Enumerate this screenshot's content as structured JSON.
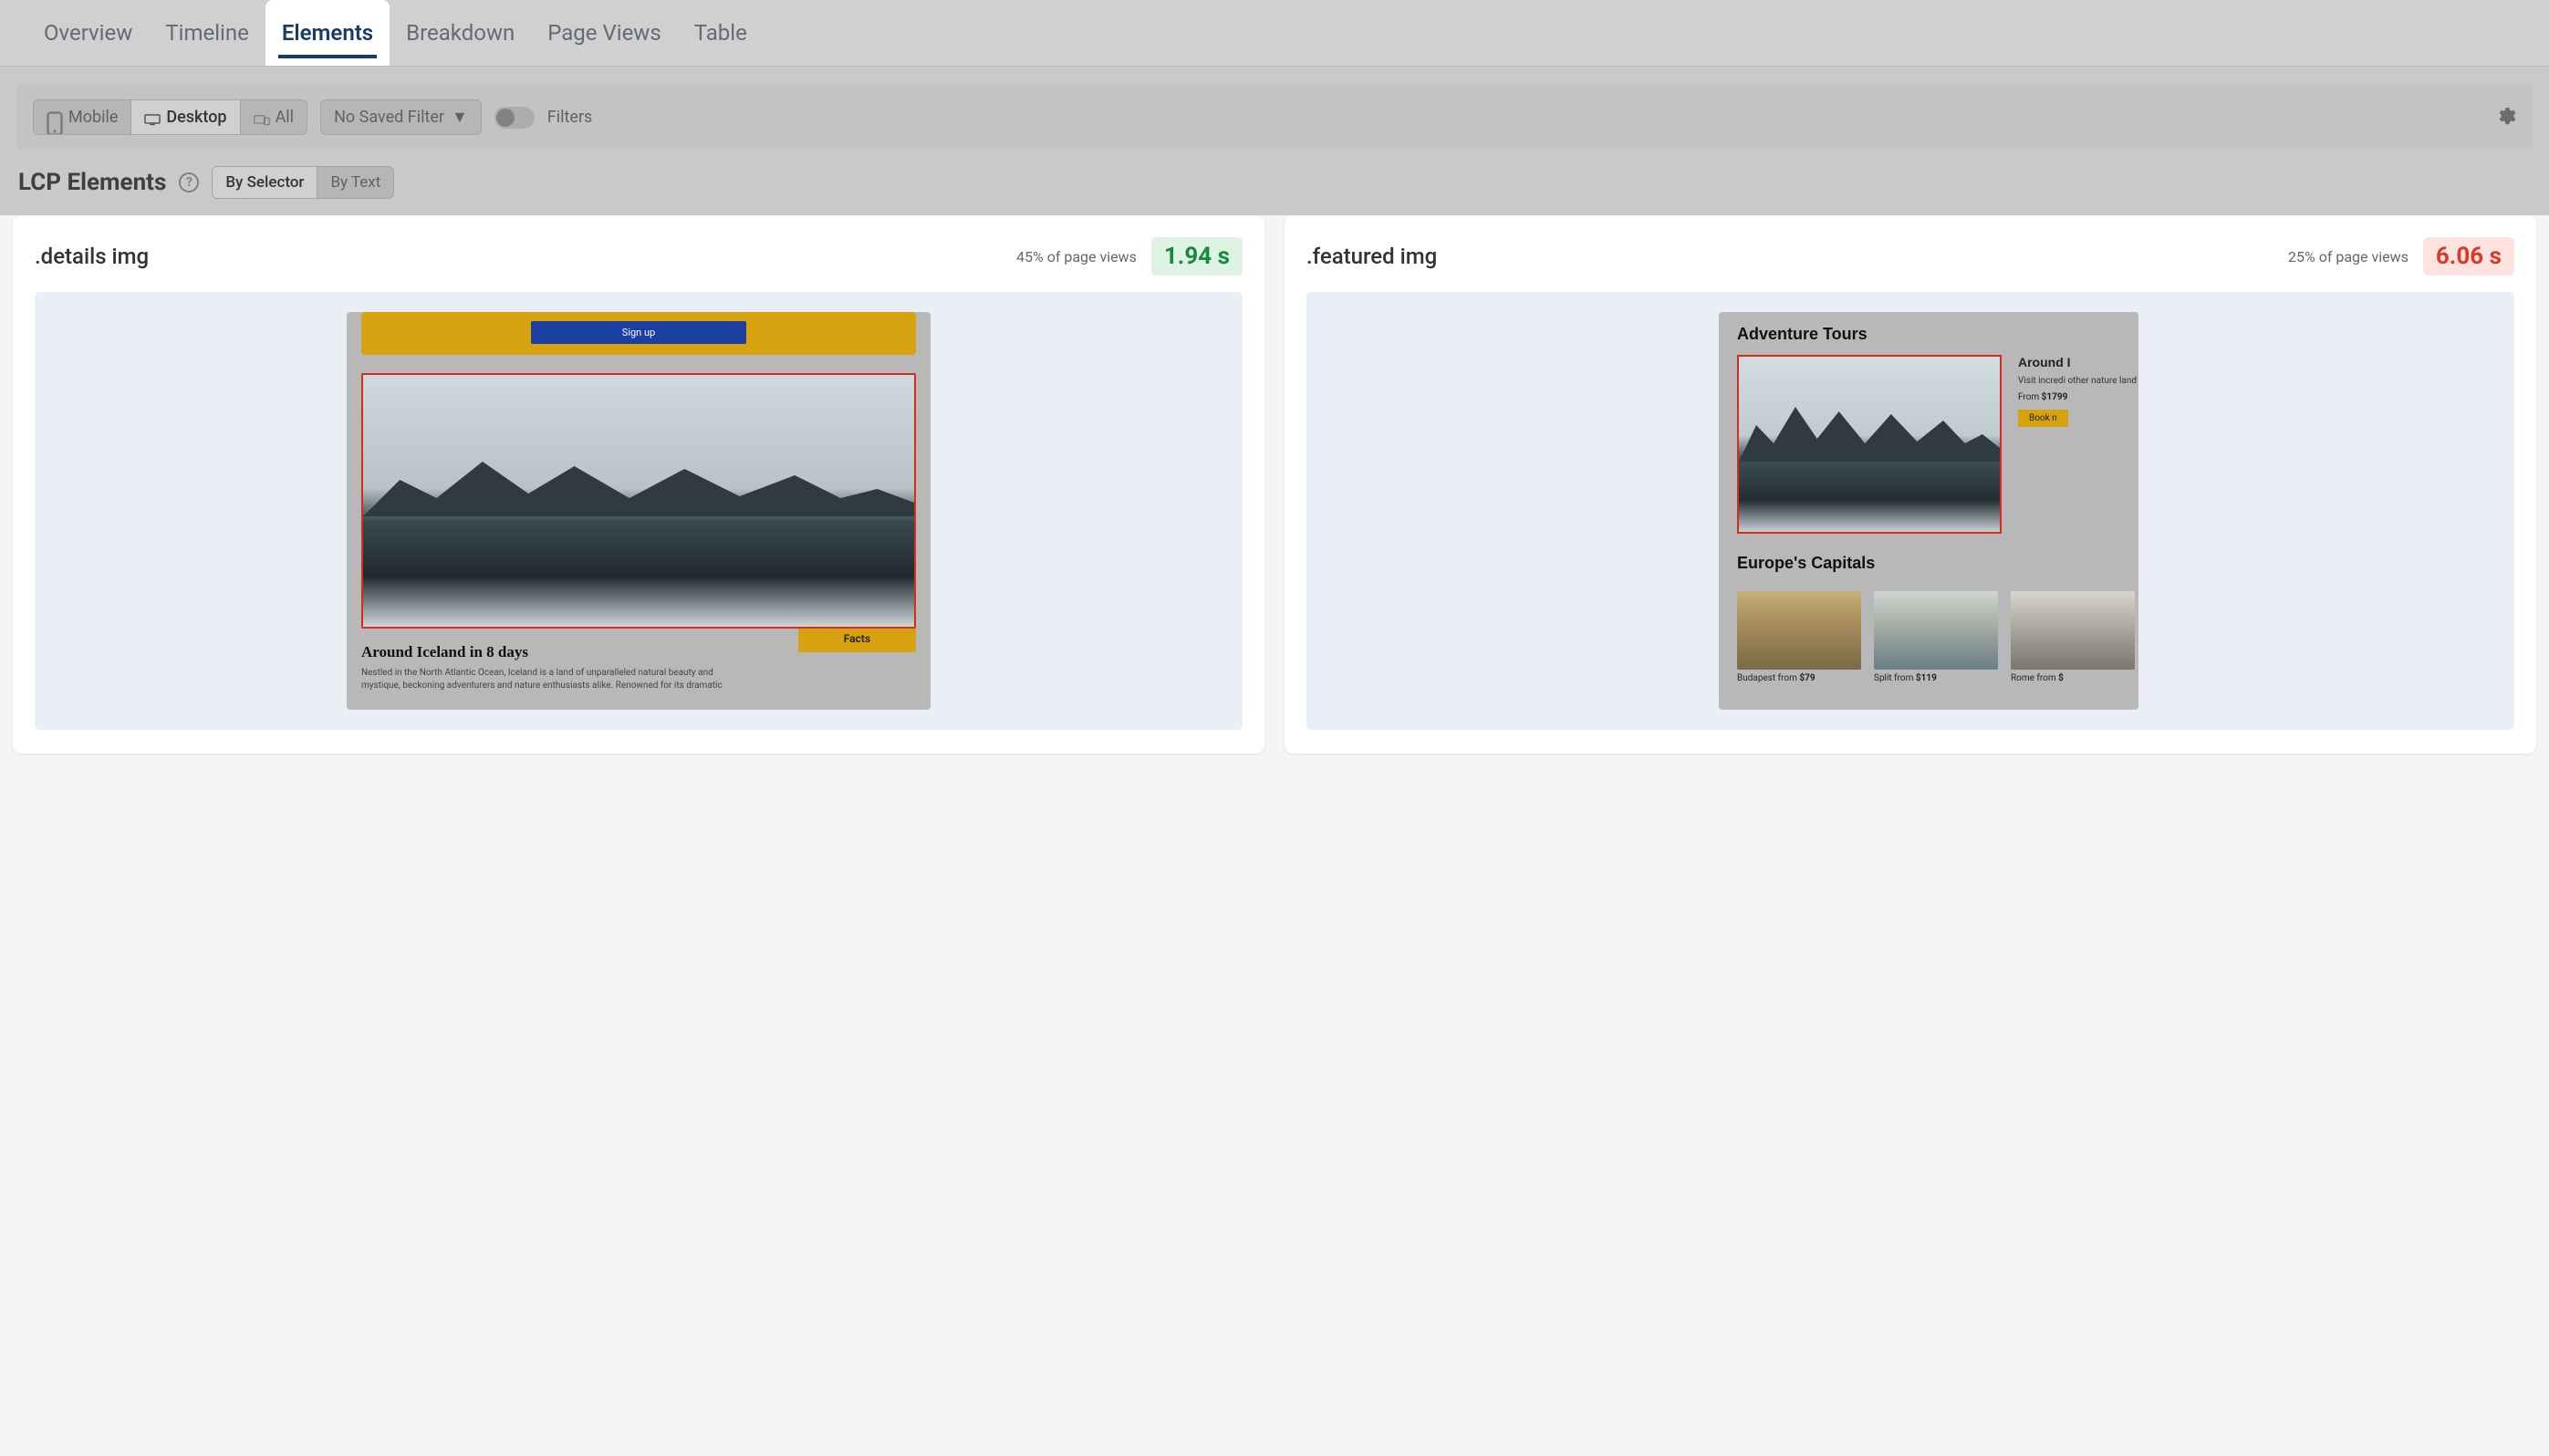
{
  "tabs": {
    "overview": "Overview",
    "timeline": "Timeline",
    "elements": "Elements",
    "breakdown": "Breakdown",
    "page_views": "Page Views",
    "table": "Table",
    "active": "elements"
  },
  "toolbar": {
    "device": {
      "mobile": "Mobile",
      "desktop": "Desktop",
      "all": "All",
      "active": "desktop"
    },
    "filter_dropdown": "No Saved Filter",
    "filters_label": "Filters"
  },
  "section": {
    "title": "LCP Elements",
    "group_by": {
      "by_selector": "By Selector",
      "by_text": "By Text",
      "active": "by_selector"
    }
  },
  "cards": [
    {
      "selector": ".details img",
      "page_views_pct": "45% of page views",
      "time": "1.94 s",
      "status": "good",
      "preview": {
        "signup_label": "Sign up",
        "heading": "Around Iceland in 8 days",
        "text": "Nestled in the North Atlantic Ocean, Iceland is a land of unparalleled natural beauty and mystique, beckoning adventurers and nature enthusiasts alike. Renowned for its dramatic",
        "facts_label": "Facts"
      }
    },
    {
      "selector": ".featured img",
      "page_views_pct": "25% of page views",
      "time": "6.06 s",
      "status": "bad",
      "preview": {
        "title": "Adventure Tours",
        "side_heading": "Around I",
        "side_text": "Visit incredi other nature landmarks a",
        "side_from_prefix": "From ",
        "side_from_price": "$1799",
        "book_label": "Book n",
        "subtitle": "Europe's Capitals",
        "thumbs": [
          {
            "caption_prefix": "Budapest from ",
            "price": "$79"
          },
          {
            "caption_prefix": "Split from ",
            "price": "$119"
          },
          {
            "caption_prefix": "Rome from ",
            "price": "$"
          }
        ]
      }
    }
  ]
}
